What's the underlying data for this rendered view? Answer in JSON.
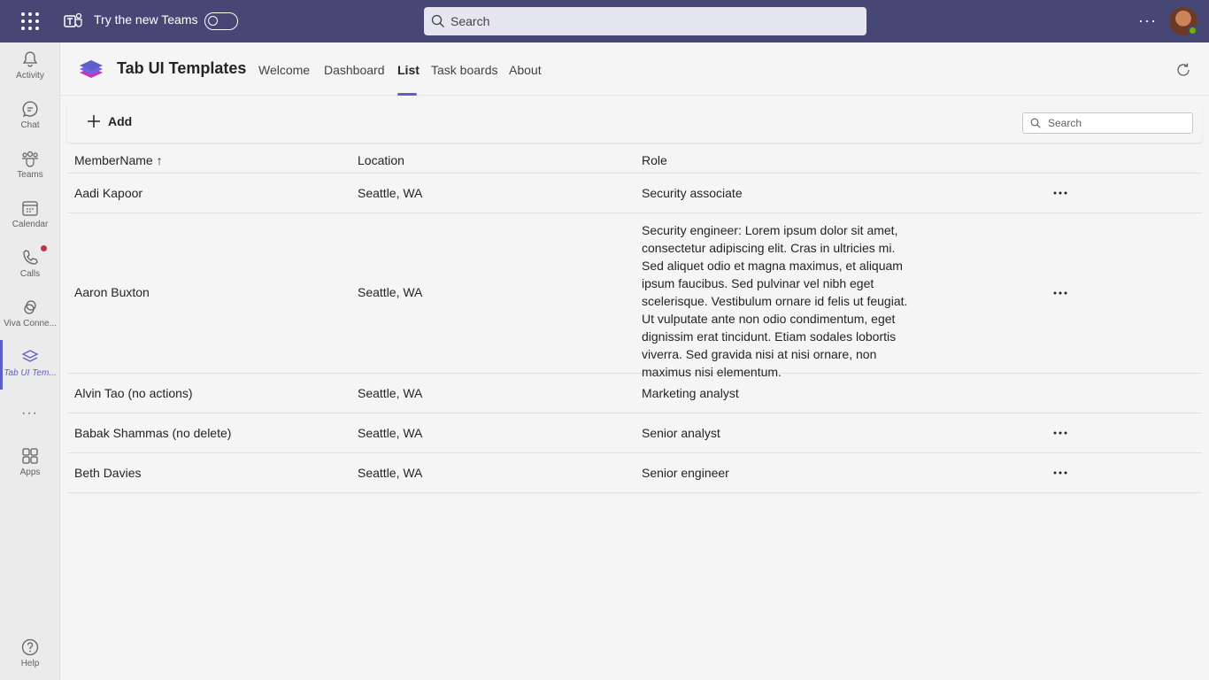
{
  "topbar": {
    "try_label": "Try the new Teams",
    "search_placeholder": "Search",
    "more_label": "···"
  },
  "rail": {
    "items": [
      {
        "label": "Activity",
        "icon": "bell-icon"
      },
      {
        "label": "Chat",
        "icon": "chat-icon"
      },
      {
        "label": "Teams",
        "icon": "teams-icon"
      },
      {
        "label": "Calendar",
        "icon": "calendar-icon"
      },
      {
        "label": "Calls",
        "icon": "phone-icon"
      },
      {
        "label": "Viva Conne...",
        "icon": "viva-connections-icon"
      },
      {
        "label": "Tab UI Tem...",
        "icon": "layers-icon"
      },
      {
        "label": "Apps",
        "icon": "apps-icon"
      },
      {
        "label": "Help",
        "icon": "help-icon"
      }
    ],
    "more_label": "···"
  },
  "app": {
    "title": "Tab UI Templates",
    "tabs": [
      "Welcome",
      "Dashboard",
      "List",
      "Task boards",
      "About"
    ],
    "active_tab": "List"
  },
  "toolbar": {
    "add_label": "Add",
    "search_placeholder": "Search"
  },
  "table": {
    "headers": [
      "MemberName ↑",
      "Location",
      "Role"
    ],
    "rows": [
      {
        "name": "Aadi Kapoor",
        "location": "Seattle, WA",
        "role": "Security associate",
        "actions": true
      },
      {
        "name": "Aaron Buxton",
        "location": "Seattle, WA",
        "role": "Security engineer: Lorem ipsum dolor sit amet, consectetur adipiscing elit. Cras in ultricies mi. Sed aliquet odio et magna maximus, et aliquam ipsum faucibus. Sed pulvinar vel nibh eget scelerisque. Vestibulum ornare id felis ut feugiat. Ut vulputate ante non odio condimentum, eget dignissim erat tincidunt. Etiam sodales lobortis viverra. Sed gravida nisi at nisi ornare, non maximus nisi elementum.",
        "actions": true
      },
      {
        "name": "Alvin Tao (no actions)",
        "location": "Seattle, WA",
        "role": "Marketing analyst",
        "actions": false
      },
      {
        "name": "Babak Shammas (no delete)",
        "location": "Seattle, WA",
        "role": "Senior analyst",
        "actions": true
      },
      {
        "name": "Beth Davies",
        "location": "Seattle, WA",
        "role": "Senior engineer",
        "actions": true
      }
    ]
  },
  "colors": {
    "topbar": "#464775",
    "accent": "#5b5fc7",
    "notification": "#c4314b",
    "presence": "#6bb700"
  }
}
